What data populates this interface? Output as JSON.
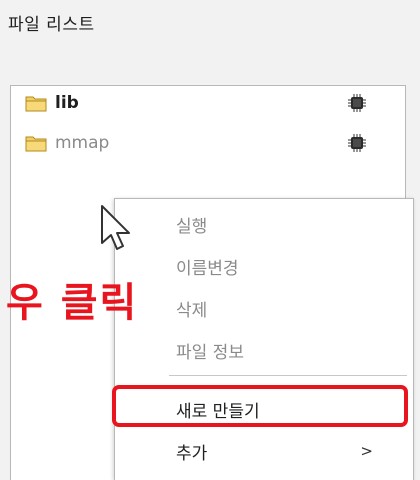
{
  "panel": {
    "title": "파일 리스트"
  },
  "files": [
    {
      "name": "lib",
      "color": "#1f1f1f",
      "icon": "folder-icon",
      "status_icon": "chip-icon"
    },
    {
      "name": "mmap",
      "color": "#8a8a8a",
      "icon": "folder-icon",
      "status_icon": "chip-icon"
    }
  ],
  "context_menu": {
    "items": [
      {
        "label": "실행",
        "enabled": false
      },
      {
        "label": "이름변경",
        "enabled": false
      },
      {
        "label": "삭제",
        "enabled": false
      },
      {
        "label": "파일 정보",
        "enabled": false
      },
      {
        "label": "새로 만들기",
        "enabled": true,
        "highlighted": true
      },
      {
        "label": "추가",
        "enabled": true,
        "submenu_arrow": ">"
      }
    ]
  },
  "annotation": {
    "text": "우 클릭",
    "color": "#e8141e"
  },
  "colors": {
    "folder": "#f0c24a",
    "highlight": "#e8141e",
    "chip": "#2b2b2b"
  }
}
